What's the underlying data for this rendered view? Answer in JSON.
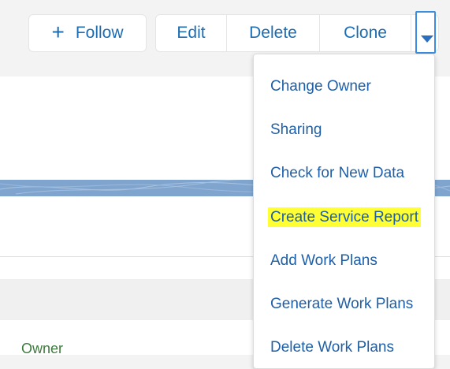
{
  "actions": {
    "follow_label": "Follow",
    "edit_label": "Edit",
    "delete_label": "Delete",
    "clone_label": "Clone"
  },
  "icons": {
    "plus": "plus-icon",
    "dropdown": "chevron-down-icon"
  },
  "menu": {
    "items": [
      {
        "label": "Change Owner"
      },
      {
        "label": "Sharing"
      },
      {
        "label": "Check for New Data"
      },
      {
        "label": "Create Service Report",
        "highlighted": true
      },
      {
        "label": "Add Work Plans"
      },
      {
        "label": "Generate Work Plans"
      },
      {
        "label": "Delete Work Plans"
      }
    ]
  },
  "fields": {
    "owner_label": "Owner"
  },
  "colors": {
    "link": "#1b6db3",
    "highlight": "#ffff33",
    "band": "#7fa5cf",
    "owner_text": "#3e7a3e"
  }
}
